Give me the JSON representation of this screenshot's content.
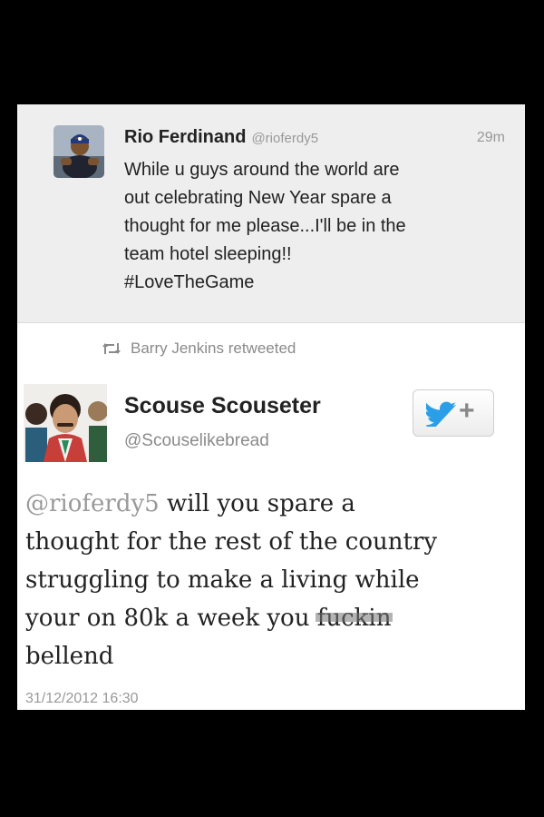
{
  "original_tweet": {
    "name": "Rio Ferdinand",
    "handle": "@rioferdy5",
    "time": "29m",
    "text_lines": [
      "While u guys around the world are",
      "out celebrating New Year spare a",
      "thought for me please...I'll be in the",
      "team hotel sleeping!!",
      "#LoveTheGame"
    ],
    "avatar_icon": "profile-photo-icon"
  },
  "retweet_notice": {
    "icon": "retweet-icon",
    "label": "Barry Jenkins retweeted"
  },
  "reply_tweet": {
    "name": "Scouse Scouseter",
    "handle": "@Scouselikebread",
    "follow_icon": "twitter-bird-icon",
    "follow_label": "+",
    "mention": "@rioferdy5",
    "text_after_mention": " will you spare a",
    "text_lines": [
      "thought for the rest of the country",
      "struggling to make a living while",
      "your on 80k a week you "
    ],
    "censored_word": "fuckin",
    "last_line": "bellend",
    "timestamp": "31/12/2012 16:30"
  },
  "colors": {
    "background": "#000000",
    "card": "#ffffff",
    "original_bg": "#eeeeee",
    "twitter_blue": "#2a9ee6",
    "muted_text": "#999999"
  }
}
